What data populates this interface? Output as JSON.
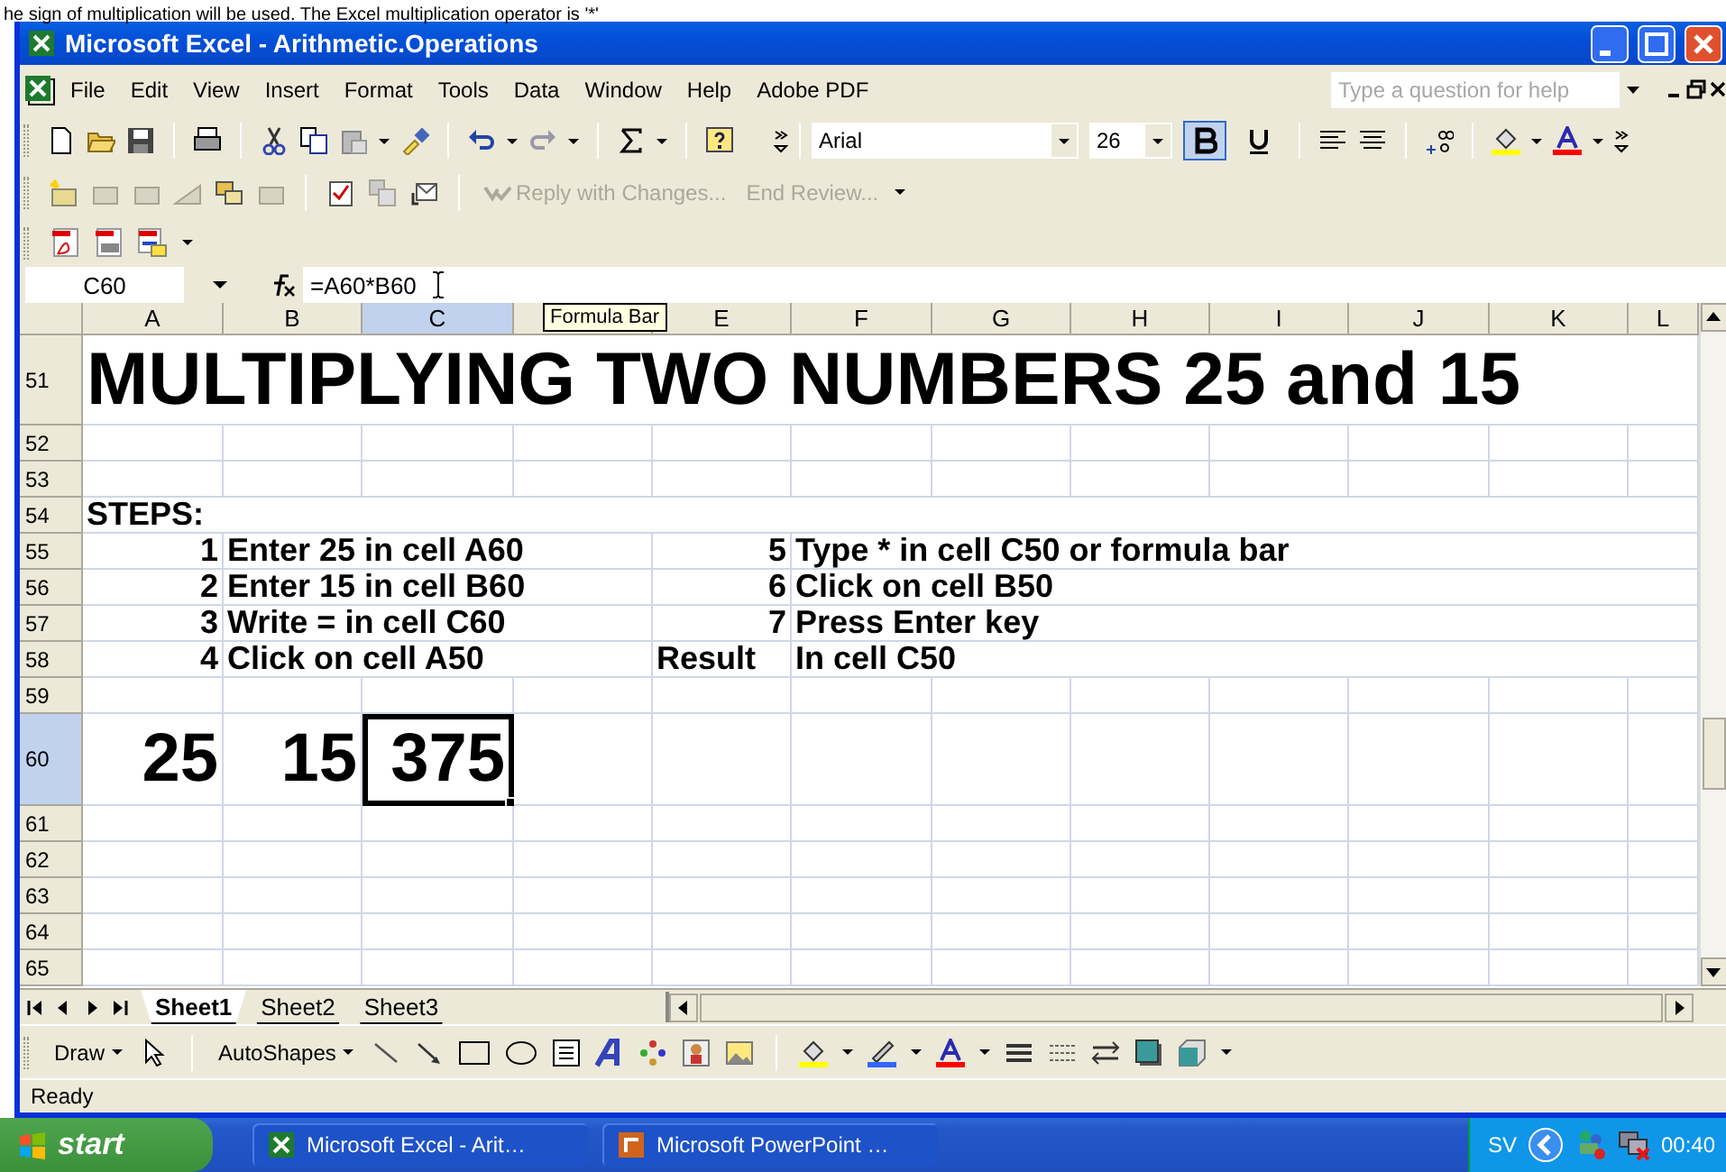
{
  "caption": "he sign of multiplication will be used. The Excel multiplication operator is '*'",
  "window": {
    "title": "Microsoft Excel - Arithmetic.Operations"
  },
  "menu": [
    "File",
    "Edit",
    "View",
    "Insert",
    "Format",
    "Tools",
    "Data",
    "Window",
    "Help",
    "Adobe PDF"
  ],
  "help_box": {
    "placeholder": "Type a question for help"
  },
  "formatting": {
    "font": "Arial",
    "size": "26",
    "bold": true,
    "underline": false
  },
  "reviewing": [
    {
      "label": "Reply with Changes...",
      "disabled": true
    },
    {
      "label": "End Review...",
      "disabled": true
    }
  ],
  "name_box": "C60",
  "formula": "=A60*B60",
  "tooltip": "Formula Bar",
  "columns": [
    {
      "label": "A",
      "selected": false
    },
    {
      "label": "B",
      "selected": false
    },
    {
      "label": "C",
      "selected": true
    },
    {
      "selected": false
    },
    {
      "label": "E",
      "selected": false
    },
    {
      "label": "F",
      "selected": false
    },
    {
      "label": "G",
      "selected": false
    },
    {
      "label": "H",
      "selected": false
    },
    {
      "label": "I",
      "selected": false
    },
    {
      "label": "J",
      "selected": false
    },
    {
      "label": "K",
      "selected": false
    },
    {
      "label": "L",
      "selected": false
    }
  ],
  "rows": [
    {
      "header": "51",
      "kind": "title",
      "selected": false,
      "cells": {
        "A": {
          "text": "MULTIPLYING TWO NUMBERS 25 and 15",
          "kind": "text",
          "selected": false
        }
      }
    },
    {
      "header": "52",
      "kind": "normal",
      "selected": false,
      "cells": {}
    },
    {
      "header": "53",
      "kind": "normal",
      "selected": false,
      "cells": {}
    },
    {
      "header": "54",
      "kind": "normal",
      "selected": false,
      "cells": {
        "A": {
          "text": "STEPS:",
          "kind": "text",
          "selected": false
        }
      }
    },
    {
      "header": "55",
      "kind": "normal",
      "selected": false,
      "cells": {
        "A": {
          "text": "1",
          "kind": "number",
          "selected": false
        },
        "B": {
          "text": "Enter 25 in cell A60",
          "kind": "text",
          "selected": false
        },
        "E": {
          "text": "5",
          "kind": "number",
          "selected": false
        },
        "F": {
          "text": "Type * in cell C50 or formula bar",
          "kind": "text",
          "selected": false
        }
      }
    },
    {
      "header": "56",
      "kind": "normal",
      "selected": false,
      "cells": {
        "A": {
          "text": "2",
          "kind": "number",
          "selected": false
        },
        "B": {
          "text": "Enter 15 in cell B60",
          "kind": "text",
          "selected": false
        },
        "E": {
          "text": "6",
          "kind": "number",
          "selected": false
        },
        "F": {
          "text": "Click on cell B50",
          "kind": "text",
          "selected": false
        }
      }
    },
    {
      "header": "57",
      "kind": "normal",
      "selected": false,
      "cells": {
        "A": {
          "text": "3",
          "kind": "number",
          "selected": false
        },
        "B": {
          "text": "Write = in cell C60",
          "kind": "text",
          "selected": false
        },
        "E": {
          "text": "7",
          "kind": "number",
          "selected": false
        },
        "F": {
          "text": "Press Enter key",
          "kind": "text",
          "selected": false
        }
      }
    },
    {
      "header": "58",
      "kind": "normal",
      "selected": false,
      "cells": {
        "A": {
          "text": "4",
          "kind": "number",
          "selected": false
        },
        "B": {
          "text": "Click on cell A50",
          "kind": "text",
          "selected": false
        },
        "E": {
          "text": "Result",
          "kind": "text",
          "selected": false
        },
        "F": {
          "text": "In cell C50",
          "kind": "text",
          "selected": false
        }
      }
    },
    {
      "header": "59",
      "kind": "normal",
      "selected": false,
      "cells": {}
    },
    {
      "header": "60",
      "kind": "big",
      "selected": true,
      "cells": {
        "A": {
          "text": "25",
          "kind": "number",
          "selected": false
        },
        "B": {
          "text": "15",
          "kind": "number",
          "selected": false
        },
        "C": {
          "text": "375",
          "kind": "number",
          "selected": true
        }
      }
    },
    {
      "header": "61",
      "kind": "normal",
      "selected": false,
      "cells": {}
    },
    {
      "header": "62",
      "kind": "normal",
      "selected": false,
      "cells": {}
    },
    {
      "header": "63",
      "kind": "normal",
      "selected": false,
      "cells": {}
    },
    {
      "header": "64",
      "kind": "normal",
      "selected": false,
      "cells": {}
    },
    {
      "header": "65",
      "kind": "normal",
      "selected": false,
      "cells": {}
    }
  ],
  "sheets": [
    {
      "label": "Sheet1",
      "selected": true
    },
    {
      "label": "Sheet2",
      "selected": false
    },
    {
      "label": "Sheet3",
      "selected": false
    }
  ],
  "draw_toolbar": [
    "Draw",
    "AutoShapes"
  ],
  "status_bar": "Ready",
  "taskbar": {
    "start": "start",
    "tasks": [
      {
        "label": "Microsoft Excel - Arit…",
        "kind": "excel"
      },
      {
        "label": "Microsoft PowerPoint …",
        "kind": "powerpoint"
      }
    ],
    "language": "SV",
    "clock": "00:40"
  }
}
